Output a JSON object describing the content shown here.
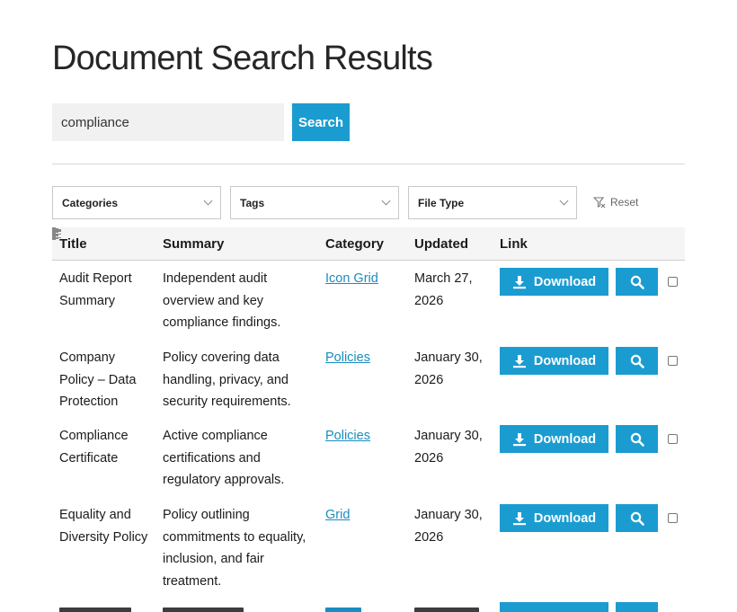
{
  "page": {
    "title": "Document Search Results"
  },
  "search": {
    "value": "compliance",
    "button_label": "Search"
  },
  "filters": [
    {
      "label": "Categories"
    },
    {
      "label": "Tags"
    },
    {
      "label": "File Type"
    }
  ],
  "reset_label": "Reset",
  "table": {
    "headers": {
      "title": "Title",
      "summary": "Summary",
      "category": "Category",
      "updated": "Updated",
      "link": "Link"
    },
    "download_label": "Download",
    "rows": [
      {
        "title": [
          "Audit Report",
          "Summary"
        ],
        "summary": [
          "Independent audit",
          "overview and key",
          "compliance findings."
        ],
        "category": "Icon Grid",
        "updated": [
          "March 27,",
          "2026"
        ]
      },
      {
        "title": [
          "Company",
          "Policy – Data",
          "Protection"
        ],
        "summary": [
          "Policy covering data",
          "handling, privacy, and",
          "security requirements."
        ],
        "category": "Policies",
        "updated": [
          "January 30,",
          "2026"
        ]
      },
      {
        "title": [
          "Compliance",
          "Certificate"
        ],
        "summary": [
          "Active compliance",
          "certifications and",
          "regulatory approvals."
        ],
        "category": "Policies",
        "updated": [
          "January 30,",
          "2026"
        ]
      },
      {
        "title": [
          "Equality and",
          "Diversity Policy"
        ],
        "summary": [
          "Policy outlining",
          "commitments to equality,",
          "inclusion, and fair",
          "treatment."
        ],
        "category": "Grid",
        "updated": [
          "January 30,",
          "2026"
        ]
      }
    ]
  }
}
